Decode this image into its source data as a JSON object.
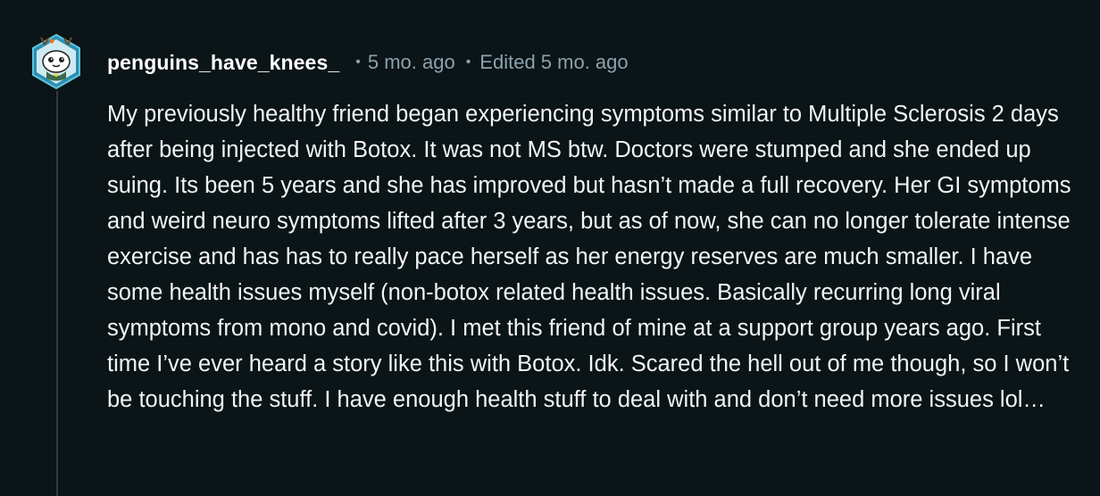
{
  "comment": {
    "username": "penguins_have_knees_",
    "separator": "•",
    "timestamp": "5 mo. ago",
    "edited": "Edited 5 mo. ago",
    "avatar_icon": "snoo-avatar-icon",
    "body": "My previously healthy friend began experiencing symptoms similar to Multiple Sclerosis 2 days after being injected with Botox. It was not MS btw. Doctors were stumped and she ended up suing. Its been 5 years and she has improved but hasn’t made a full recovery. Her GI symptoms and weird neuro symptoms lifted after 3 years, but as of now, she can no longer tolerate intense exercise and has has to really pace herself as her energy reserves are much smaller. I have some health issues myself (non-botox related health issues. Basically recurring long viral symptoms from mono and covid). I met this friend of mine at a support group years ago. First time I’ve ever heard a story like this with Botox. Idk. Scared the hell out of me though, so I won’t be touching the stuff. I have enough health stuff to deal with and don’t need more issues lol…"
  },
  "colors": {
    "background": "#0b1416",
    "text": "#f2f4f5",
    "meta": "#8ba2ad",
    "thread_line": "#33393c",
    "avatar_ring": "#2c8fb0"
  }
}
